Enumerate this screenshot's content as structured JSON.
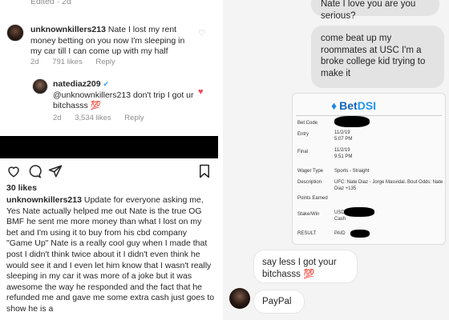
{
  "left": {
    "edited_meta": "Edited · 2d",
    "comment1": {
      "username": "unknownkillers213",
      "text": "Nate I lost my rent money betting on you now I'm sleeping in my car till I can come up with my half",
      "age": "2d",
      "likes": "791 likes",
      "reply": "Reply"
    },
    "reply1": {
      "username": "natediaz209",
      "verified": "✔",
      "text": "@unknownkillers213 don't trip I got ur bitchasss 💯",
      "age": "2d",
      "likes": "3,534 likes",
      "reply": "Reply"
    },
    "post": {
      "likes": "30 likes",
      "username": "unknownkillers213",
      "caption": "Update for everyone asking me, Yes Nate actually helped me out Nate is the true OG BMF he sent me more money than what I lost on my bet  and I'm using it to buy from his cbd company \"Game Up\" Nate is a really cool guy when I made that post I didn't think twice about it I didn't even think he would see it and I even let him know that I wasn't really sleeping in my car it was more of a joke but it was awesome the way he responded and the fact that he refunded me and gave me some extra cash just goes to show he is a"
    },
    "icons": [
      "heart-icon",
      "comment-icon",
      "share-icon",
      "bookmark-icon"
    ]
  },
  "right": {
    "msg_top": "Nate I love you are you serious?",
    "msg_mid": "come beat up my roommates at USC I'm a broke college kid trying to make it",
    "slip": {
      "brand_prefix": "Bet",
      "brand_suffix": "DSI",
      "rows": [
        {
          "label": "Bet Code",
          "value": ""
        },
        {
          "label": "Entry",
          "value": "11/2/19\n5:07 PM"
        },
        {
          "label": "Final",
          "value": "11/2/19\n9:51 PM"
        },
        {
          "label": "Wager Type",
          "value": "Sports - Straight"
        },
        {
          "label": "Description",
          "value": "UFC: Nate Diaz - Jorge Masvidal. Bout Odds: Nate Diaz +135"
        },
        {
          "label": "Points Earned",
          "value": ""
        },
        {
          "label": "Stake/Win",
          "value": "USD\nCash"
        },
        {
          "label": "RESULT",
          "value": "PAID"
        }
      ]
    },
    "msg_less": "say less I got your bitchasss 💯",
    "msg_paypal": "PayPal"
  }
}
